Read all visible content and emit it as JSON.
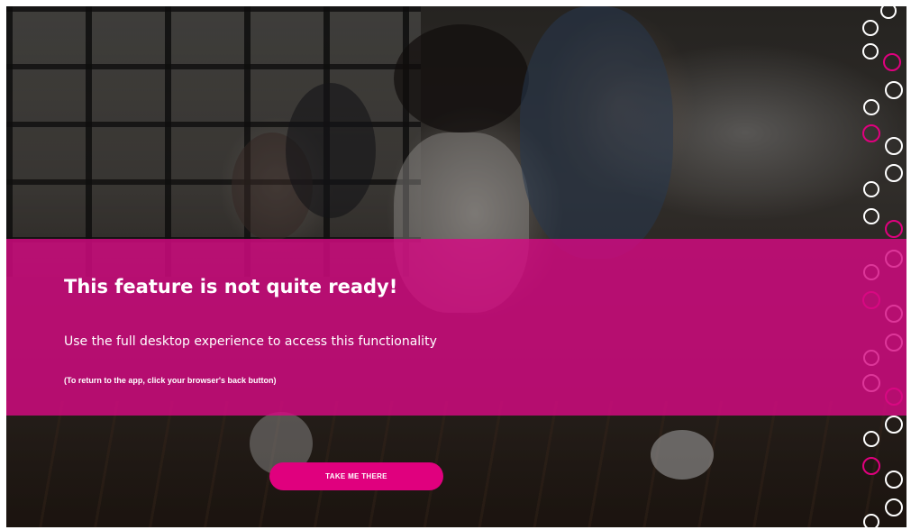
{
  "notice": {
    "heading": "This feature is not quite ready!",
    "subtitle": "Use the full desktop experience to access this functionality",
    "note": "(To return to the app, click your browser's back button)"
  },
  "cta": {
    "label": "TAKE ME THERE"
  },
  "colors": {
    "accent_pink": "#e0007e",
    "band_pink": "#d60a82",
    "text": "#ffffff"
  },
  "background": {
    "description_icon": "photo-people-celebrating-icon"
  }
}
